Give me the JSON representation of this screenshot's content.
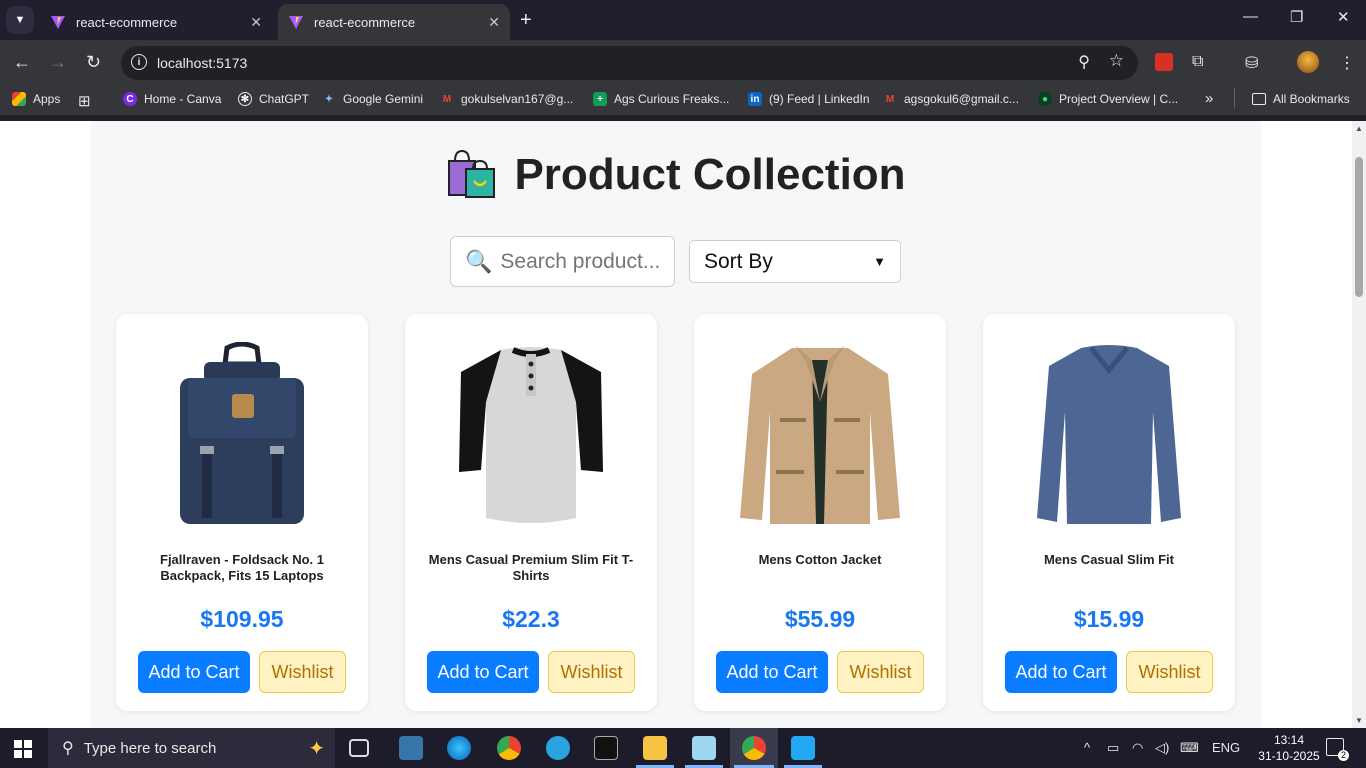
{
  "browser": {
    "tabs": [
      {
        "title": "react-ecommerce"
      },
      {
        "title": "react-ecommerce"
      }
    ],
    "url": "localhost:5173",
    "bookmarks": [
      {
        "label": "Apps"
      },
      {
        "label": "Home - Canva"
      },
      {
        "label": "ChatGPT"
      },
      {
        "label": "Google Gemini"
      },
      {
        "label": "gokulselvan167@g..."
      },
      {
        "label": "Ags Curious Freaks..."
      },
      {
        "label": "(9) Feed | LinkedIn"
      },
      {
        "label": "agsgokul6@gmail.c..."
      },
      {
        "label": "Project Overview | C..."
      }
    ],
    "all_bookmarks": "All Bookmarks",
    "more_bookmarks": "»"
  },
  "page": {
    "title": "Product Collection",
    "search": {
      "placeholder": "Search product..."
    },
    "sort": {
      "selected": "Sort By"
    },
    "products": [
      {
        "name": "Fjallraven - Foldsack No. 1 Backpack, Fits 15 Laptops",
        "price": "$109.95",
        "cart_label": "Add to Cart",
        "wish_label": "Wishlist"
      },
      {
        "name": "Mens Casual Premium Slim Fit T-Shirts",
        "price": "$22.3",
        "cart_label": "Add to Cart",
        "wish_label": "Wishlist"
      },
      {
        "name": "Mens Cotton Jacket",
        "price": "$55.99",
        "cart_label": "Add to Cart",
        "wish_label": "Wishlist"
      },
      {
        "name": "Mens Casual Slim Fit",
        "price": "$15.99",
        "cart_label": "Add to Cart",
        "wish_label": "Wishlist"
      }
    ]
  },
  "taskbar": {
    "search_placeholder": "Type here to search",
    "language": "ENG",
    "time": "13:14",
    "date": "31-10-2025",
    "notifications": "2"
  },
  "colors": {
    "accent": "#0a7cff",
    "price": "#1877f2",
    "wishlist_bg": "#fff3c4"
  }
}
